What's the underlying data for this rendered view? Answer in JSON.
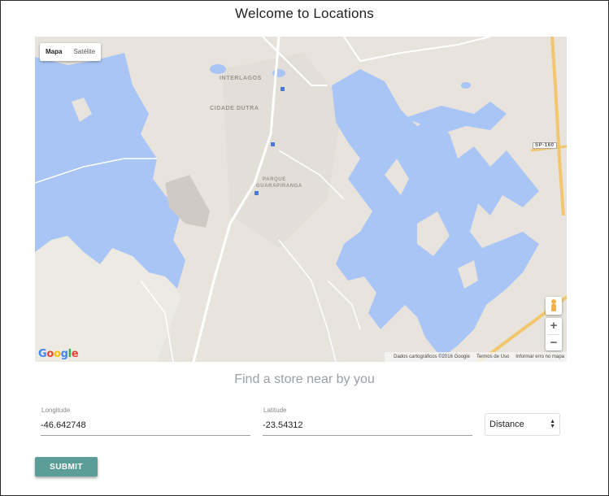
{
  "page": {
    "title": "Welcome to Locations"
  },
  "map": {
    "type_control": {
      "options": [
        "Mapa",
        "Satélite"
      ],
      "selected": "Mapa"
    },
    "labels": {
      "neighborhood_1": "INTERLAGOS",
      "neighborhood_2": "CIDADE DUTRA",
      "park_1": "PARQUE",
      "park_2": "GUARAPIRANGA",
      "road_shield": "SP-160"
    },
    "zoom": {
      "in_label": "+",
      "out_label": "−"
    },
    "logo_text": "Google",
    "attribution": {
      "data": "Dados cartográficos ©2016 Google",
      "terms": "Termos de Uso",
      "report": "Informar erro no mapa"
    },
    "colors": {
      "land": "#e8e4dd",
      "water": "#a8c5f5",
      "highway": "#f2c66d",
      "road": "#ffffff"
    }
  },
  "search": {
    "heading": "Find a store near by you",
    "longitude": {
      "label": "Longitude",
      "value": "-46.642748"
    },
    "latitude": {
      "label": "Latitude",
      "value": "-23.54312"
    },
    "distance": {
      "selected": "Distance"
    },
    "submit_label": "SUBMIT",
    "accent_color": "#5b9e98"
  }
}
